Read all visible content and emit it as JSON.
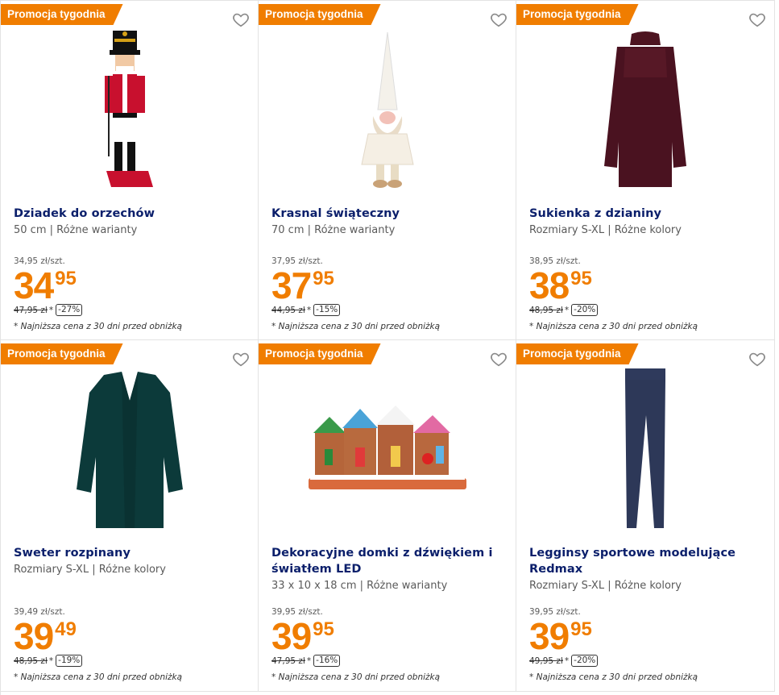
{
  "badge_label": "Promocja tygodnia",
  "accent_color": "#f07d00",
  "title_color": "#0b1f6b",
  "products": [
    {
      "image_icon": "nutcracker-figure-image",
      "title": "Dziadek do orzechów",
      "subtitle": "50 cm | Różne warianty",
      "unit_price": "34,95 zł/szt.",
      "price_int": "34",
      "price_dec": "95",
      "old_price": "47,95 zł",
      "old_star": "*",
      "discount": "-27%",
      "note": "* Najniższa cena z 30 dni przed obniżką"
    },
    {
      "image_icon": "christmas-gnome-image",
      "title": "Krasnal świąteczny",
      "subtitle": "70 cm | Różne warianty",
      "unit_price": "37,95 zł/szt.",
      "price_int": "37",
      "price_dec": "95",
      "old_price": "44,95 zł",
      "old_star": "*",
      "discount": "-15%",
      "note": "* Najniższa cena z 30 dni przed obniżką"
    },
    {
      "image_icon": "knit-dress-image",
      "title": "Sukienka z dzianiny",
      "subtitle": "Rozmiary S-XL | Różne kolory",
      "unit_price": "38,95 zł/szt.",
      "price_int": "38",
      "price_dec": "95",
      "old_price": "48,95 zł",
      "old_star": "*",
      "discount": "-20%",
      "note": "* Najniższa cena z 30 dni przed obniżką"
    },
    {
      "image_icon": "cardigan-sweater-image",
      "title": "Sweter rozpinany",
      "subtitle": "Rozmiary S-XL | Różne kolory",
      "unit_price": "39,49 zł/szt.",
      "price_int": "39",
      "price_dec": "49",
      "old_price": "48,95 zł",
      "old_star": "*",
      "discount": "-19%",
      "note": "* Najniższa cena z 30 dni przed obniżką"
    },
    {
      "image_icon": "decorative-houses-image",
      "title": "Dekoracyjne domki z dźwiękiem i światłem LED",
      "subtitle": "33 x 10 x 18 cm | Różne warianty",
      "unit_price": "39,95 zł/szt.",
      "price_int": "39",
      "price_dec": "95",
      "old_price": "47,95 zł",
      "old_star": "*",
      "discount": "-16%",
      "note": "* Najniższa cena z 30 dni przed obniżką"
    },
    {
      "image_icon": "leggings-image",
      "title": "Legginsy sportowe modelujące Redmax",
      "subtitle": "Rozmiary S-XL | Różne kolory",
      "unit_price": "39,95 zł/szt.",
      "price_int": "39",
      "price_dec": "95",
      "old_price": "49,95 zł",
      "old_star": "*",
      "discount": "-20%",
      "note": "* Najniższa cena z 30 dni przed obniżką"
    }
  ]
}
